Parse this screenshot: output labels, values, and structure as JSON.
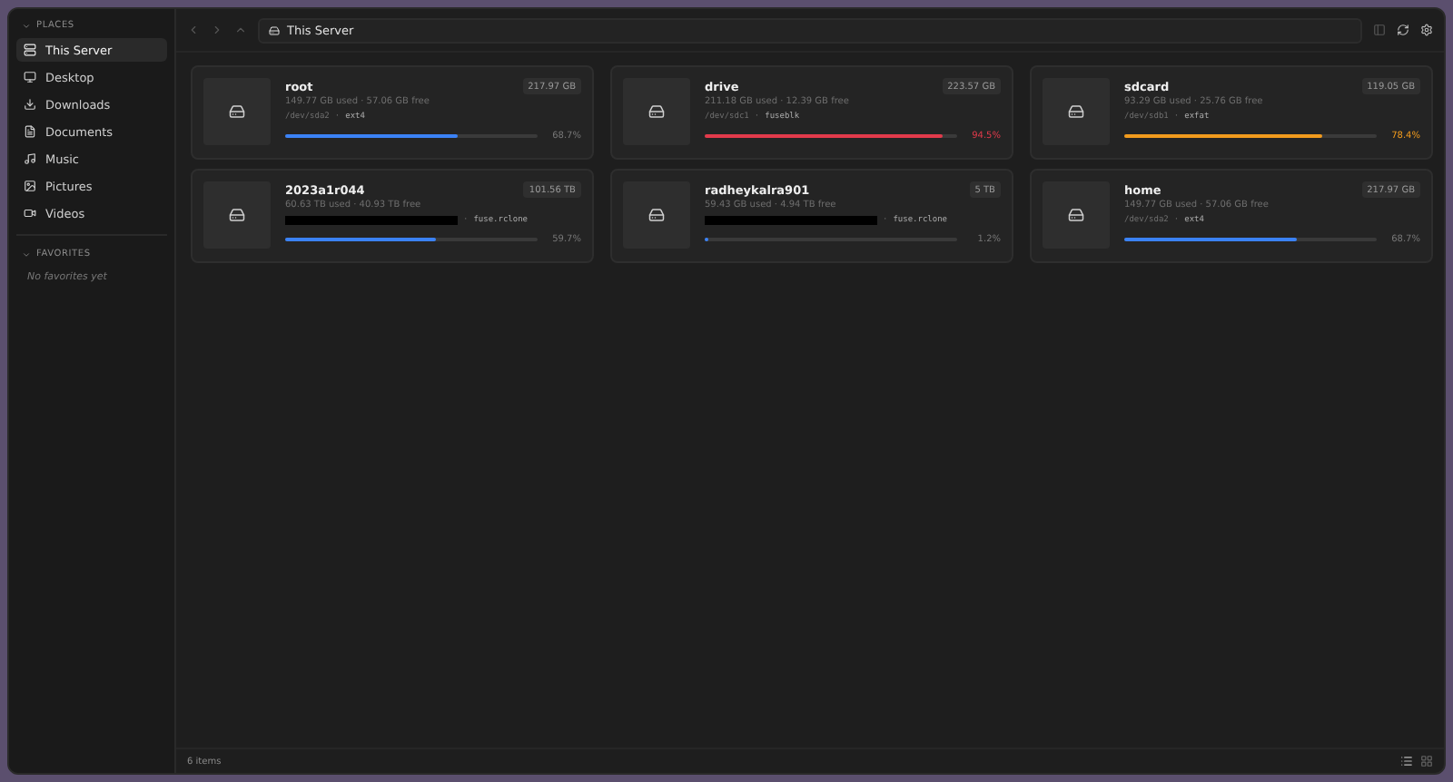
{
  "sidebar": {
    "sections": [
      {
        "title": "PLACES",
        "expanded": true,
        "items": [
          {
            "label": "This Server",
            "selected": true
          },
          {
            "label": "Desktop",
            "selected": false
          },
          {
            "label": "Downloads",
            "selected": false
          },
          {
            "label": "Documents",
            "selected": false
          },
          {
            "label": "Music",
            "selected": false
          },
          {
            "label": "Pictures",
            "selected": false
          },
          {
            "label": "Videos",
            "selected": false
          }
        ]
      },
      {
        "title": "FAVORITES",
        "expanded": true,
        "empty_text": "No favorites yet"
      }
    ]
  },
  "toolbar": {
    "path": "This Server"
  },
  "devices": [
    {
      "name": "root",
      "size": "217.97 GB",
      "usage": "149.77 GB used · 57.06 GB free",
      "device": "/dev/sda2",
      "redacted": false,
      "separator": "·",
      "fs": "ext4",
      "level": 0.687,
      "percent": "68.7%",
      "color": "#3b82f6"
    },
    {
      "name": "drive",
      "size": "223.57 GB",
      "usage": "211.18 GB used · 12.39 GB free",
      "device": "/dev/sdc1",
      "redacted": false,
      "separator": "·",
      "fs": "fuseblk",
      "level": 0.945,
      "percent": "94.5%",
      "color": "#e23a4b"
    },
    {
      "name": "sdcard",
      "size": "119.05 GB",
      "usage": "93.29 GB used · 25.76 GB free",
      "device": "/dev/sdb1",
      "redacted": false,
      "separator": "·",
      "fs": "exfat",
      "level": 0.784,
      "percent": "78.4%",
      "color": "#f29b1d"
    },
    {
      "name": "2023a1r044",
      "size": "101.56 TB",
      "usage": "60.63 TB used · 40.93 TB free",
      "redacted": true,
      "separator": "·",
      "fs": "fuse.rclone",
      "level": 0.597,
      "percent": "59.7%",
      "color": "#3b82f6"
    },
    {
      "name": "radheykalra901",
      "size": "5 TB",
      "usage": "59.43 GB used · 4.94 TB free",
      "redacted": true,
      "separator": "·",
      "fs": "fuse.rclone",
      "level": 0.012,
      "percent": "1.2%",
      "color": "#3b82f6"
    },
    {
      "name": "home",
      "size": "217.97 GB",
      "usage": "149.77 GB used · 57.06 GB free",
      "device": "/dev/sda2",
      "redacted": false,
      "separator": "·",
      "fs": "ext4",
      "level": 0.687,
      "percent": "68.7%",
      "color": "#3b82f6"
    }
  ],
  "status_bar": {
    "count": "6 items"
  }
}
